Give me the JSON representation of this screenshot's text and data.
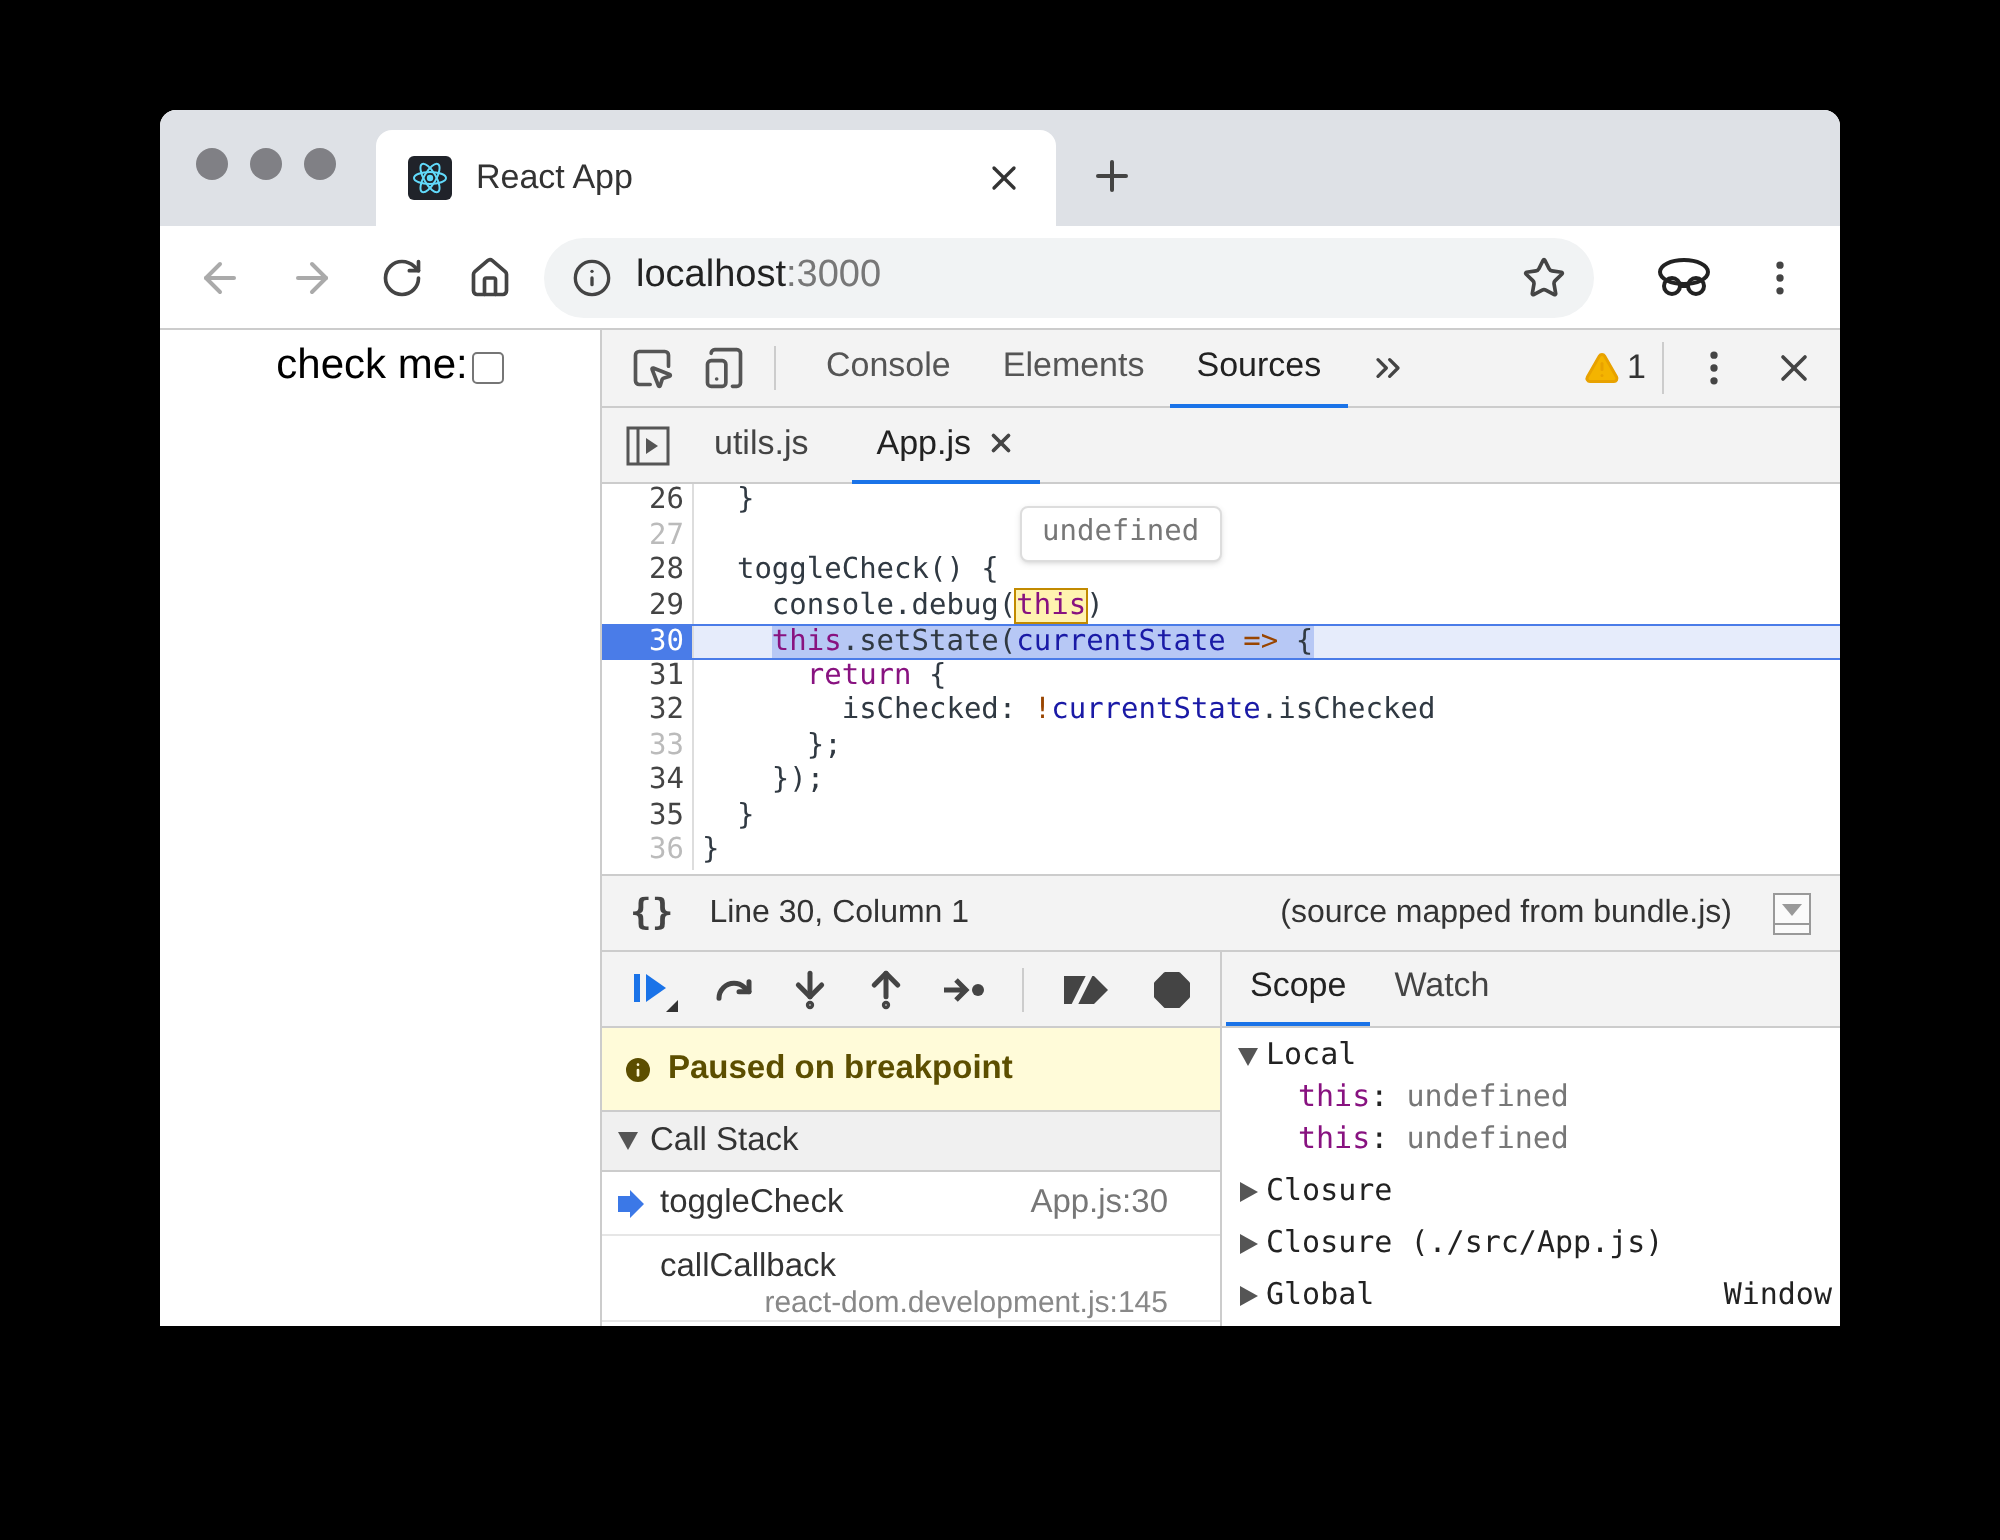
{
  "browser": {
    "tab": {
      "title": "React App"
    },
    "address": {
      "host": "localhost",
      "port": ":3000"
    }
  },
  "page": {
    "checkbox": {
      "label": "check me:",
      "checked": false
    }
  },
  "devtools": {
    "tabs": [
      {
        "label": "Console",
        "selected": false
      },
      {
        "label": "Elements",
        "selected": false
      },
      {
        "label": "Sources",
        "selected": true
      }
    ],
    "warnings": "1",
    "files": [
      {
        "label": "utils.js",
        "selected": false
      },
      {
        "label": "App.js",
        "selected": true
      }
    ],
    "code": [
      {
        "number": "26",
        "breakable": true,
        "current": false,
        "tokens": [
          {
            "kind": "plain",
            "text": "  }"
          }
        ]
      },
      {
        "number": "27",
        "breakable": false,
        "current": false
      },
      {
        "number": "28",
        "breakable": true,
        "current": false,
        "tokens": [
          {
            "kind": "plain",
            "text": "  toggleCheck() {"
          }
        ]
      },
      {
        "number": "29",
        "breakable": true,
        "current": false,
        "tokens": [
          {
            "kind": "plain",
            "text": "    console.debug("
          },
          {
            "kind": "hovered",
            "text": "this"
          },
          {
            "kind": "plain",
            "text": ")"
          }
        ]
      },
      {
        "number": "30",
        "breakable": true,
        "current": true,
        "tokens": [
          {
            "kind": "keyword",
            "text": "    this"
          },
          {
            "kind": "plain",
            "text": ".setState("
          },
          {
            "kind": "variable",
            "text": "currentState"
          },
          {
            "kind": "operator",
            "text": " =>"
          },
          {
            "kind": "plain",
            "text": " {"
          }
        ]
      },
      {
        "number": "31",
        "breakable": true,
        "current": false,
        "tokens": [
          {
            "kind": "keyword",
            "text": "      return"
          },
          {
            "kind": "plain",
            "text": " {"
          }
        ]
      },
      {
        "number": "32",
        "breakable": true,
        "current": false,
        "tokens": [
          {
            "kind": "plain",
            "text": "        isChecked: "
          },
          {
            "kind": "operator",
            "text": "!"
          },
          {
            "kind": "variable",
            "text": "currentState"
          },
          {
            "kind": "plain",
            "text": ".isChecked"
          }
        ]
      },
      {
        "number": "33",
        "breakable": false,
        "current": false,
        "tokens": [
          {
            "kind": "plain",
            "text": "      };"
          }
        ]
      },
      {
        "number": "34",
        "breakable": true,
        "current": false,
        "tokens": [
          {
            "kind": "plain",
            "text": "    });"
          }
        ]
      },
      {
        "number": "35",
        "breakable": true,
        "current": false,
        "tokens": [
          {
            "kind": "plain",
            "text": "  }"
          }
        ]
      },
      {
        "number": "36",
        "breakable": false,
        "current": false,
        "tokens": [
          {
            "kind": "plain",
            "text": "}"
          }
        ]
      }
    ],
    "tooltip": "undefined",
    "status": {
      "braces": "{}",
      "position": "Line 30, Column 1",
      "source": "(source mapped from bundle.js)"
    },
    "pause_message": "Paused on breakpoint",
    "call_stack": {
      "title": "Call Stack",
      "expanded": true,
      "frames": [
        {
          "name": "toggleCheck",
          "location": "App.js:30",
          "selected": true
        },
        {
          "name": "callCallback",
          "location": "react-dom.development.js:145",
          "selected": false
        }
      ]
    },
    "side_tabs": [
      {
        "label": "Scope",
        "selected": true
      },
      {
        "label": "Watch",
        "selected": false
      }
    ],
    "scope": [
      {
        "name": "Local",
        "expanded": true,
        "children": [
          {
            "key": "this",
            "separator": ":",
            "value": "undefined"
          },
          {
            "key": "this",
            "separator": ":",
            "value": "undefined"
          }
        ]
      },
      {
        "name": "Closure",
        "expanded": false
      },
      {
        "name": "Closure (./src/App.js)",
        "expanded": false
      },
      {
        "name": "Global",
        "expanded": false,
        "value": "Window"
      }
    ]
  }
}
